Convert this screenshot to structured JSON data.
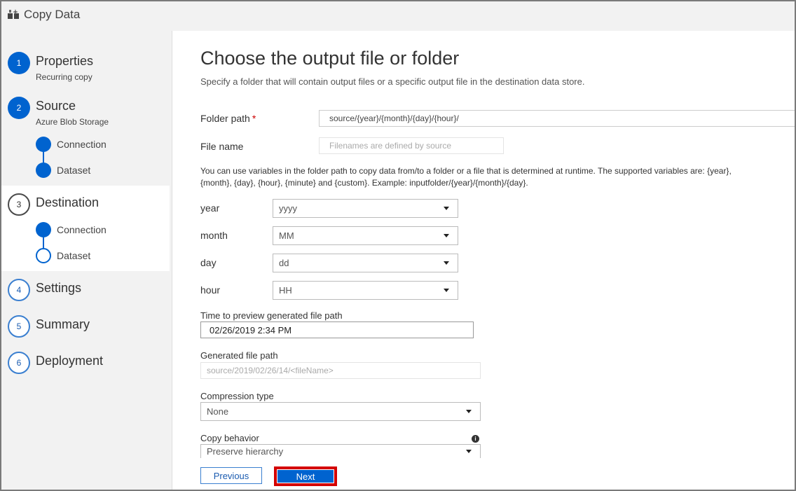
{
  "window": {
    "title": "Copy Data"
  },
  "steps": [
    {
      "num": "1",
      "label": "Properties",
      "sub": "Recurring copy"
    },
    {
      "num": "2",
      "label": "Source",
      "sub": "Azure Blob Storage",
      "substeps": [
        {
          "label": "Connection"
        },
        {
          "label": "Dataset"
        }
      ]
    },
    {
      "num": "3",
      "label": "Destination",
      "substeps": [
        {
          "label": "Connection"
        },
        {
          "label": "Dataset"
        }
      ]
    },
    {
      "num": "4",
      "label": "Settings"
    },
    {
      "num": "5",
      "label": "Summary"
    },
    {
      "num": "6",
      "label": "Deployment"
    }
  ],
  "main": {
    "heading": "Choose the output file or folder",
    "description": "Specify a folder that will contain output files or a specific output file in the destination data store.",
    "folder_path": {
      "label": "Folder path",
      "required_mark": "*",
      "value": "source/{year}/{month}/{day}/{hour}/"
    },
    "file_name": {
      "label": "File name",
      "placeholder": "Filenames are defined by source"
    },
    "help_text": "You can use variables in the folder path to copy data from/to a folder or a file that is determined at runtime. The supported variables are: {year}, {month}, {day}, {hour}, {minute} and {custom}. Example: inputfolder/{year}/{month}/{day}.",
    "variables": [
      {
        "label": "year",
        "value": "yyyy"
      },
      {
        "label": "month",
        "value": "MM"
      },
      {
        "label": "day",
        "value": "dd"
      },
      {
        "label": "hour",
        "value": "HH"
      }
    ],
    "preview_time": {
      "label": "Time to preview generated file path",
      "value": "02/26/2019 2:34 PM"
    },
    "generated_path": {
      "label": "Generated file path",
      "value": "source/2019/02/26/14/<fileName>"
    },
    "compression": {
      "label": "Compression type",
      "value": "None"
    },
    "copy_behavior": {
      "label": "Copy behavior",
      "value": "Preserve hierarchy"
    },
    "buttons": {
      "previous": "Previous",
      "next": "Next"
    }
  },
  "colors": {
    "accent": "#0063cf",
    "highlight": "#d40000"
  }
}
